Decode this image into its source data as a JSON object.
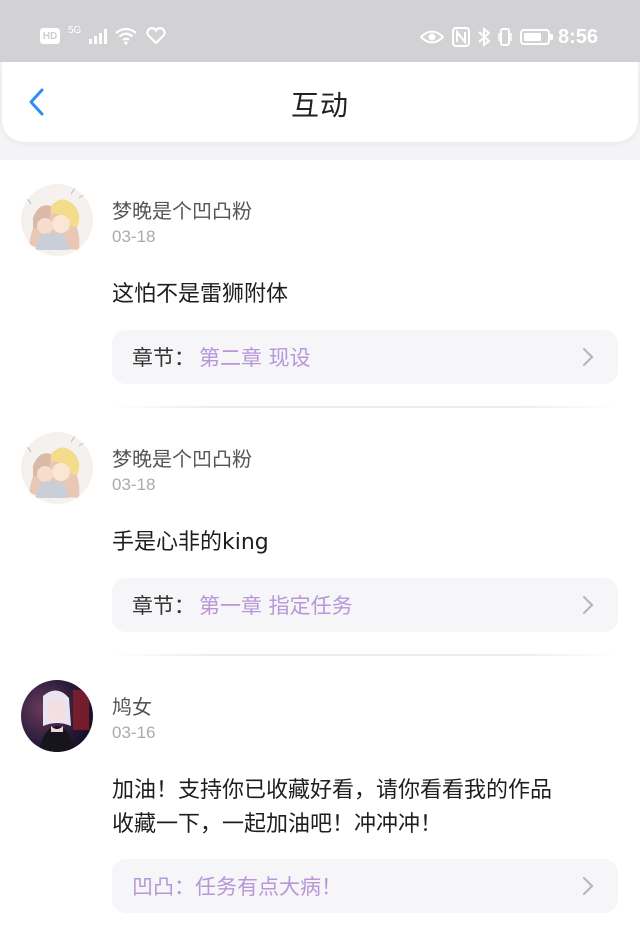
{
  "status_bar": {
    "hd": "HD",
    "network": "5G",
    "time": "8:56",
    "battery_level": 0.75
  },
  "header": {
    "title": "互动"
  },
  "comments": [
    {
      "user": "梦晚是个凹凸粉",
      "date": "03-18",
      "text": "这怕不是雷狮附体",
      "chapter_label": "章节：",
      "chapter_title": "第二章 现设",
      "avatar": "anime-pair-avatar"
    },
    {
      "user": "梦晚是个凹凸粉",
      "date": "03-18",
      "text": "手是心非的king",
      "chapter_label": "章节：",
      "chapter_title": "第一章 指定任务",
      "avatar": "anime-pair-avatar"
    },
    {
      "user": "鸠女",
      "date": "03-16",
      "text_line1": "加油！支持你已收藏好看，请你看看我的作品",
      "text_line2": "收藏一下，一起加油吧！冲冲冲！",
      "book_title": "凹凸：任务有点大病！",
      "avatar": "photo-girl-avatar"
    }
  ],
  "colors": {
    "accent": "#2f8ef5",
    "chapter_link": "#b796d9",
    "status_bar_bg": "#d2d2d4"
  }
}
